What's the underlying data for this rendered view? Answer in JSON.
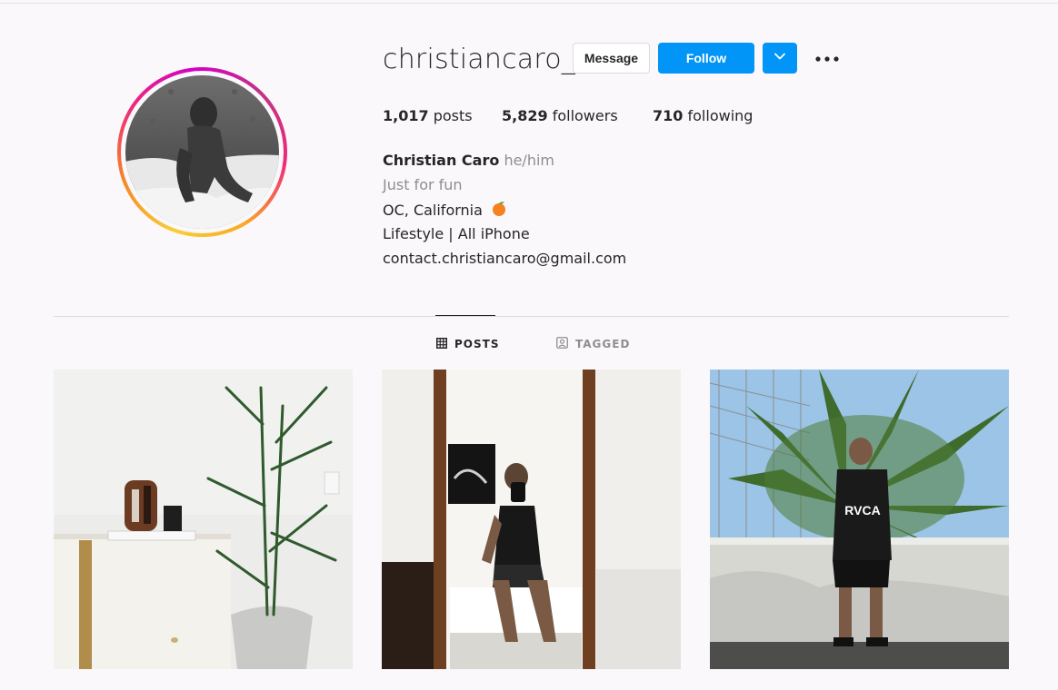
{
  "profile": {
    "username": "christiancaro_",
    "avatar_alt": "profile-photo"
  },
  "actions": {
    "message_label": "Message",
    "follow_label": "Follow",
    "dropdown_icon": "chevron-down-icon",
    "more_icon": "more-horizontal-icon"
  },
  "stats": {
    "posts_count": "1,017",
    "posts_label": "posts",
    "followers_count": "5,829",
    "followers_label": "followers",
    "following_count": "710",
    "following_label": "following"
  },
  "bio": {
    "full_name": "Christian Caro",
    "pronouns": "he/him",
    "category": "Just for fun",
    "location": "OC, California",
    "location_emoji": "🍊",
    "tagline": "Lifestyle | All iPhone",
    "email": "contact.christiancaro@gmail.com"
  },
  "tabs": [
    {
      "label": "POSTS",
      "icon": "grid-icon",
      "active": true
    },
    {
      "label": "TAGGED",
      "icon": "tagged-icon",
      "active": false
    }
  ],
  "colors": {
    "follow_blue": "#0095f6",
    "background": "#fbf8fb",
    "muted_text": "#8e8e8e"
  },
  "posts": [
    {
      "description": "post-interior-plant"
    },
    {
      "description": "post-mirror-selfie"
    },
    {
      "description": "post-palm-outdoor"
    }
  ]
}
